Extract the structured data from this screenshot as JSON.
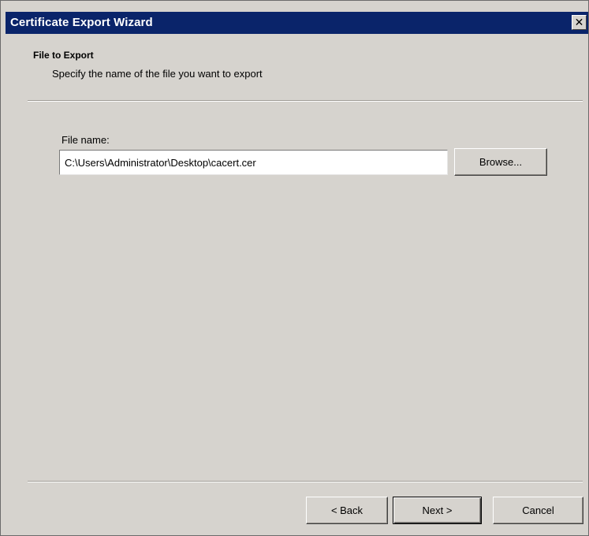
{
  "window": {
    "title": "Certificate Export Wizard",
    "close_glyph": "✕"
  },
  "header": {
    "step_title": "File to Export",
    "step_subtitle": "Specify the name of the file you want to export"
  },
  "form": {
    "file_name_label": "File name:",
    "file_name_value": "C:\\Users\\Administrator\\Desktop\\cacert.cer",
    "browse_label": "Browse..."
  },
  "footer": {
    "back_label": "< Back",
    "next_label": "Next >",
    "cancel_label": "Cancel"
  },
  "colors": {
    "titlebar": "#0a246a",
    "dialog_face": "#d6d3ce"
  }
}
